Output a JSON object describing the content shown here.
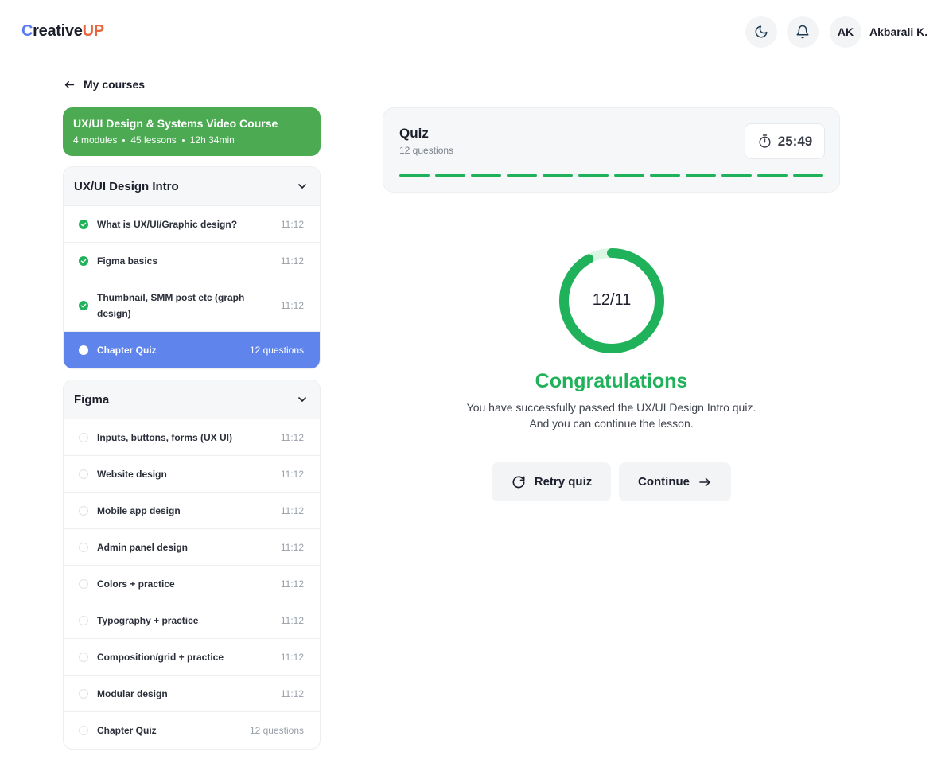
{
  "brand": {
    "logo_c": "C",
    "logo_reative": "reative",
    "logo_up": "UP"
  },
  "header": {
    "avatar_initials": "AK",
    "user_name": "Akbarali K."
  },
  "nav": {
    "back_label": "My courses"
  },
  "course": {
    "title": "UX/UI Design & Systems Video Course",
    "modules": "4 modules",
    "lessons": "45 lessons",
    "duration": "12h 34min"
  },
  "modules": [
    {
      "title": "UX/UI Design Intro",
      "lessons": [
        {
          "name": "What is UX/UI/Graphic design?",
          "meta": "11:12",
          "status": "done"
        },
        {
          "name": "Figma basics",
          "meta": "11:12",
          "status": "done"
        },
        {
          "name": "Thumbnail, SMM post etc (graph design)",
          "meta": "11:12",
          "status": "done"
        },
        {
          "name": "Chapter Quiz",
          "meta": "12 questions",
          "status": "active"
        }
      ]
    },
    {
      "title": "Figma",
      "lessons": [
        {
          "name": "Inputs, buttons, forms (UX UI)",
          "meta": "11:12",
          "status": "todo"
        },
        {
          "name": "Website design",
          "meta": "11:12",
          "status": "todo"
        },
        {
          "name": "Mobile app design",
          "meta": "11:12",
          "status": "todo"
        },
        {
          "name": "Admin panel design",
          "meta": "11:12",
          "status": "todo"
        },
        {
          "name": "Colors + practice",
          "meta": "11:12",
          "status": "todo"
        },
        {
          "name": "Typography + practice",
          "meta": "11:12",
          "status": "todo"
        },
        {
          "name": "Composition/grid + practice",
          "meta": "11:12",
          "status": "todo"
        },
        {
          "name": "Modular design",
          "meta": "11:12",
          "status": "todo"
        },
        {
          "name": "Chapter Quiz",
          "meta": "12 questions",
          "status": "todo"
        }
      ]
    }
  ],
  "quiz": {
    "title": "Quiz",
    "subtitle": "12 questions",
    "timer": "25:49",
    "segments_total": 12,
    "segments_done": 12
  },
  "result": {
    "score": "12/11",
    "progress_fraction": 0.92,
    "title": "Congratulations",
    "message_line1": "You have successfully passed the UX/UI Design Intro quiz.",
    "message_line2": "And you can continue the lesson.",
    "retry_label": "Retry quiz",
    "continue_label": "Continue"
  },
  "colors": {
    "accent_green": "#1fb25a",
    "course_green": "#4caa53",
    "active_blue": "#5f85ec",
    "brand_blue": "#5b7cf0",
    "brand_orange": "#e8643c"
  },
  "icons": {
    "theme": "moon-icon",
    "notifications": "bell-icon",
    "back": "arrow-left-icon",
    "expand": "chevron-down-icon",
    "done": "check-circle-icon",
    "timer": "stopwatch-icon",
    "retry": "refresh-icon",
    "continue": "arrow-right-icon"
  }
}
